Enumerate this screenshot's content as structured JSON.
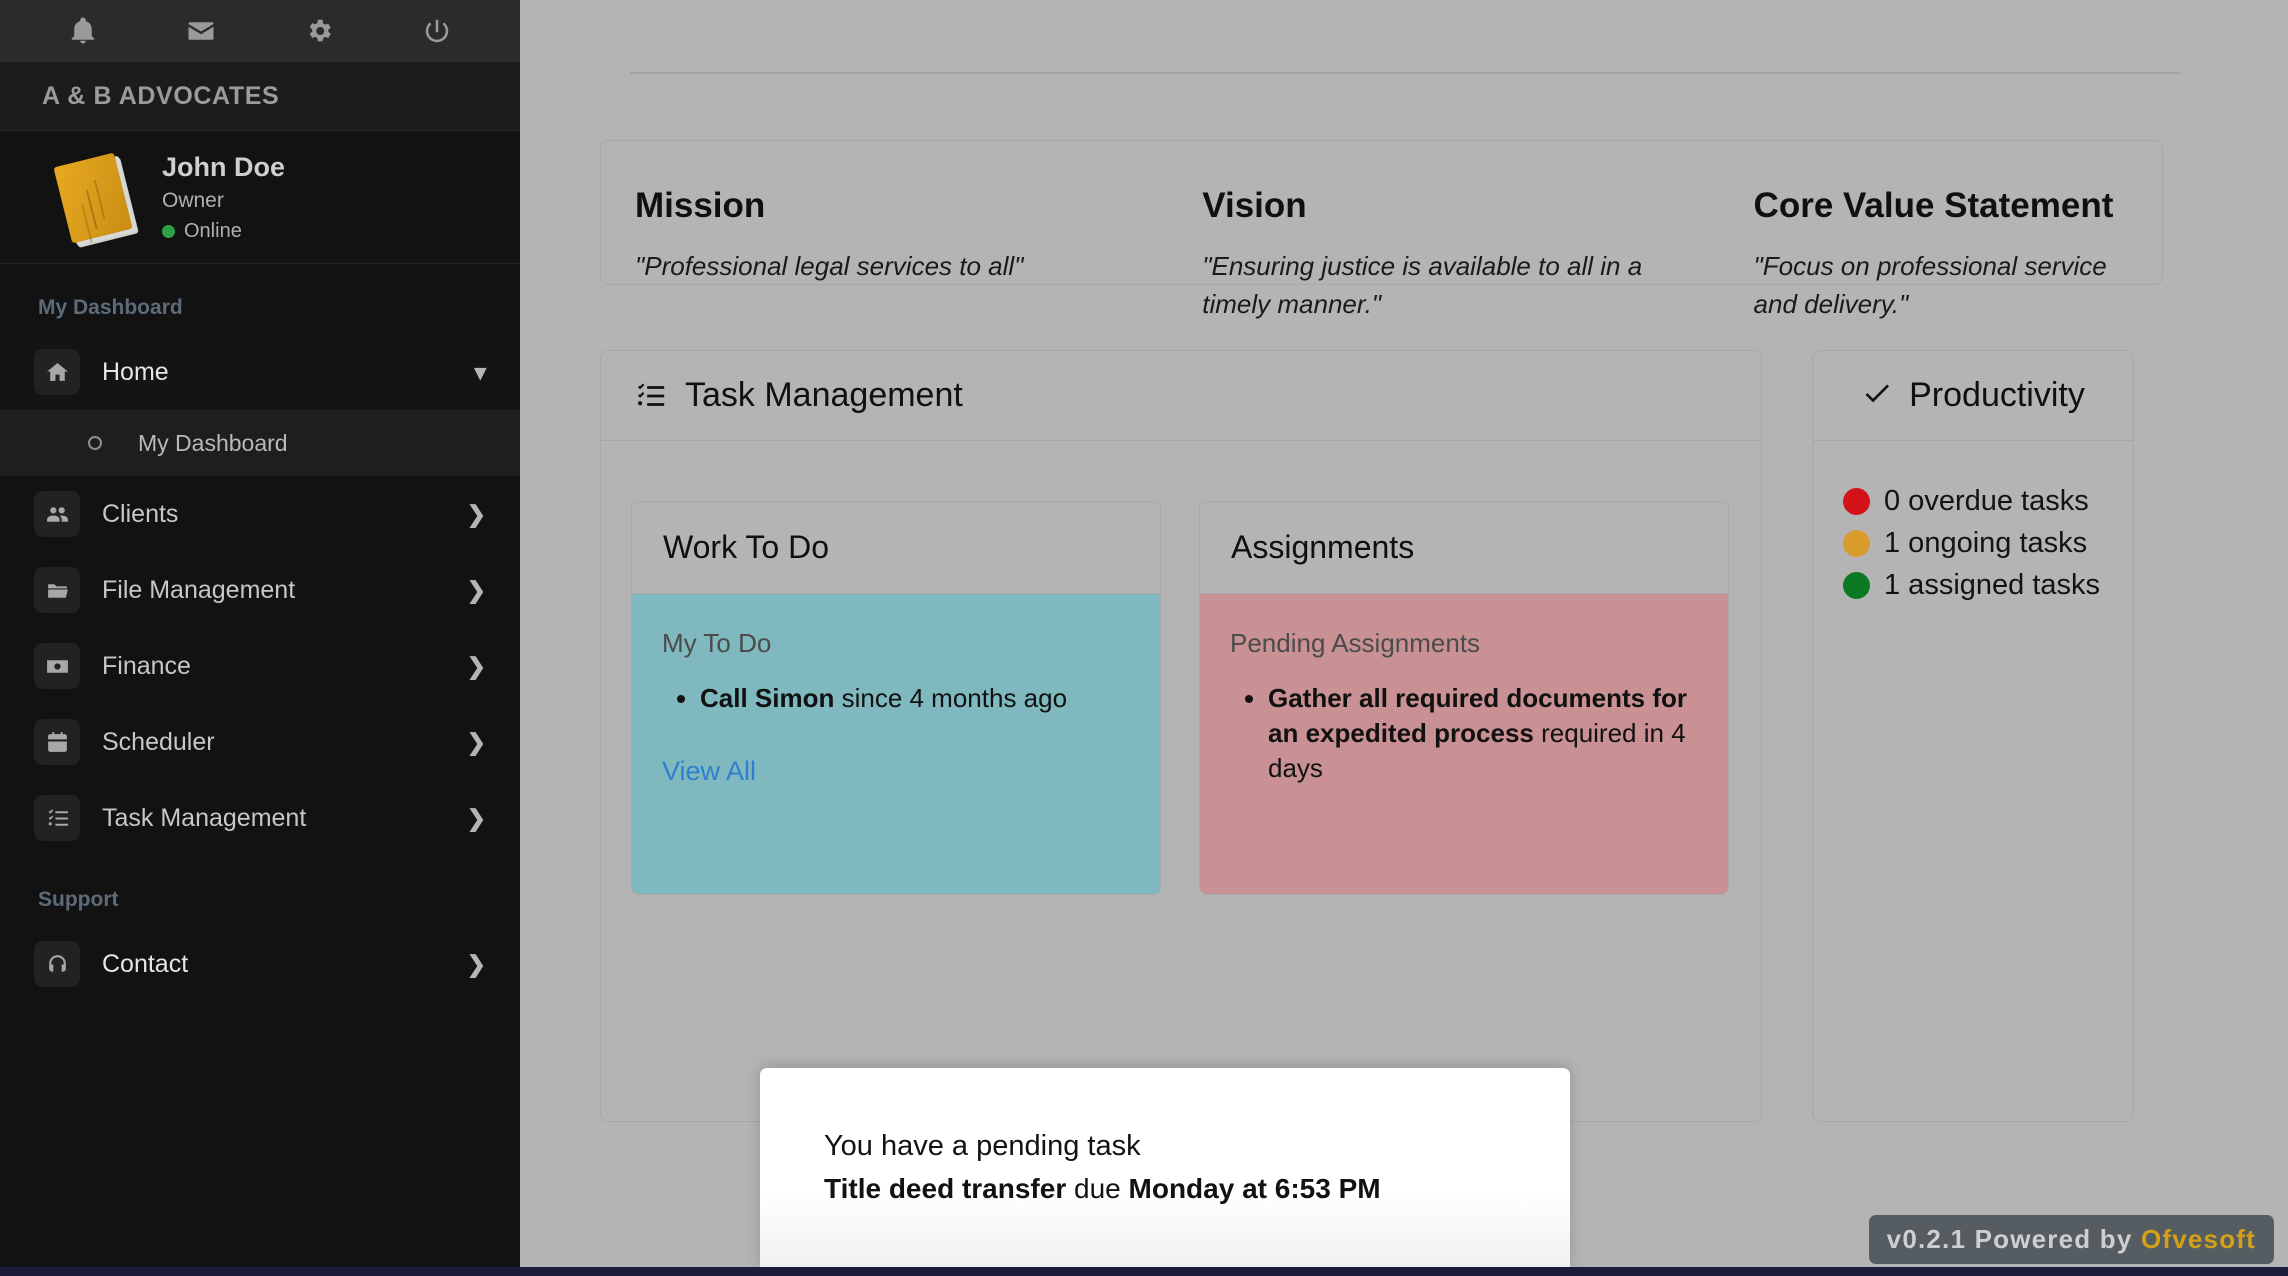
{
  "sidebar": {
    "topbar_icons": [
      {
        "name": "bell-icon",
        "label": "Notifications"
      },
      {
        "name": "envelope-icon",
        "label": "Messages"
      },
      {
        "name": "gear-icon",
        "label": "Settings"
      },
      {
        "name": "power-icon",
        "label": "Log out"
      }
    ],
    "brand": "A & B ADVOCATES",
    "profile": {
      "name": "John Doe",
      "role": "Owner",
      "status": "Online",
      "status_color": "#2fa04a",
      "avatar_icon": "book-avatar"
    },
    "sections": [
      {
        "title": "My Dashboard",
        "items": [
          {
            "label": "Home",
            "icon": "home-icon",
            "chevron": "down",
            "expanded": true,
            "children": [
              {
                "label": "My Dashboard",
                "selected": true
              }
            ]
          },
          {
            "label": "Clients",
            "icon": "users-icon",
            "chevron": "right"
          },
          {
            "label": "File Management",
            "icon": "folder-icon",
            "chevron": "right"
          },
          {
            "label": "Finance",
            "icon": "money-icon",
            "chevron": "right"
          },
          {
            "label": "Scheduler",
            "icon": "calendar-icon",
            "chevron": "right"
          },
          {
            "label": "Task Management",
            "icon": "checklist-icon",
            "chevron": "right"
          }
        ]
      },
      {
        "title": "Support",
        "items": [
          {
            "label": "Contact",
            "icon": "headset-icon",
            "chevron": "right"
          }
        ]
      }
    ]
  },
  "main": {
    "statements": [
      {
        "heading": "Mission",
        "text": "\"Professional legal services to all\""
      },
      {
        "heading": "Vision",
        "text": "\"Ensuring justice is available to all in a timely manner.\""
      },
      {
        "heading": "Core Value Statement",
        "text": "\"Focus on professional service and delivery.\""
      }
    ],
    "task_management": {
      "title": "Task Management",
      "icon": "checklist-icon",
      "work_to_do": {
        "title": "Work To Do",
        "subtitle": "My To Do",
        "item_bold": "Call Simon",
        "item_rest": " since 4 months ago",
        "link": "View All",
        "bg_color": "#7fb8bf"
      },
      "assignments": {
        "title": "Assignments",
        "subtitle": "Pending Assignments",
        "item_bold": "Gather all required documents for an expedited process",
        "item_rest": " required in 4 days",
        "bg_color": "#c99194"
      }
    },
    "productivity": {
      "title": "Productivity",
      "icon": "check-icon",
      "rows": [
        {
          "text": "0 overdue tasks",
          "color": "#d3121a"
        },
        {
          "text": "1 ongoing tasks",
          "color": "#d99b2b"
        },
        {
          "text": "1 assigned tasks",
          "color": "#0b7a22"
        }
      ]
    }
  },
  "toast": {
    "line1": "You have a pending task",
    "task_name": "Title deed transfer",
    "middle": " due ",
    "due": "Monday at 6:53 PM"
  },
  "footer_badge": {
    "version_text": "v0.2.1 Powered by ",
    "brand": "Ofvesoft",
    "brand_color": "#d4a017"
  }
}
